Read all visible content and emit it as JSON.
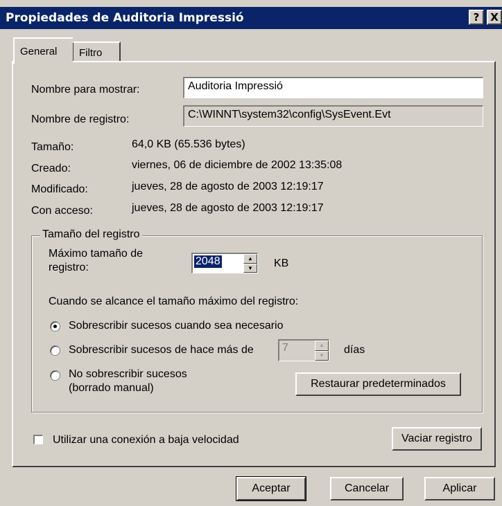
{
  "window": {
    "title": "Propiedades de Auditoria Impressió",
    "help_label": "?",
    "close_label": "X"
  },
  "tabs": [
    {
      "label": "General",
      "active": true
    },
    {
      "label": "Filtro",
      "active": false
    }
  ],
  "general": {
    "display_name_label": "Nombre para mostrar:",
    "display_name_value": "Auditoria Impressió",
    "log_name_label": "Nombre de registro:",
    "log_name_value": "C:\\WINNT\\system32\\config\\SysEvent.Evt",
    "size_label": "Tamaño:",
    "size_value": "64,0 KB (65.536 bytes)",
    "created_label": "Creado:",
    "created_value": "viernes, 06 de diciembre de 2002 13:35:08",
    "modified_label": "Modificado:",
    "modified_value": "jueves, 28 de agosto de 2003 12:19:17",
    "accessed_label": "Con acceso:",
    "accessed_value": "jueves, 28 de agosto de 2003 12:19:17"
  },
  "log_size": {
    "group_label": "Tamaño del registro",
    "max_size_label_line1": "Máximo tamaño de",
    "max_size_label_line2": "registro:",
    "max_size_value": "2048",
    "max_size_unit": "KB",
    "when_full_label": "Cuando se alcance el tamaño máximo del registro:",
    "option_overwrite": "Sobrescribir sucesos cuando sea necesario",
    "option_overwrite_older": "Sobrescribir sucesos de hace más de",
    "days_value": "7",
    "days_unit": "días",
    "option_no_overwrite_line1": "No sobrescribir sucesos",
    "option_no_overwrite_line2": "(borrado manual)",
    "selected_option": "option_overwrite",
    "restore_defaults_button": "Restaurar predeterminados"
  },
  "low_speed_label": "Utilizar una conexión a baja velocidad",
  "low_speed_checked": false,
  "clear_log_button": "Vaciar registro",
  "footer": {
    "ok_button": "Aceptar",
    "cancel_button": "Cancelar",
    "apply_button": "Aplicar"
  }
}
